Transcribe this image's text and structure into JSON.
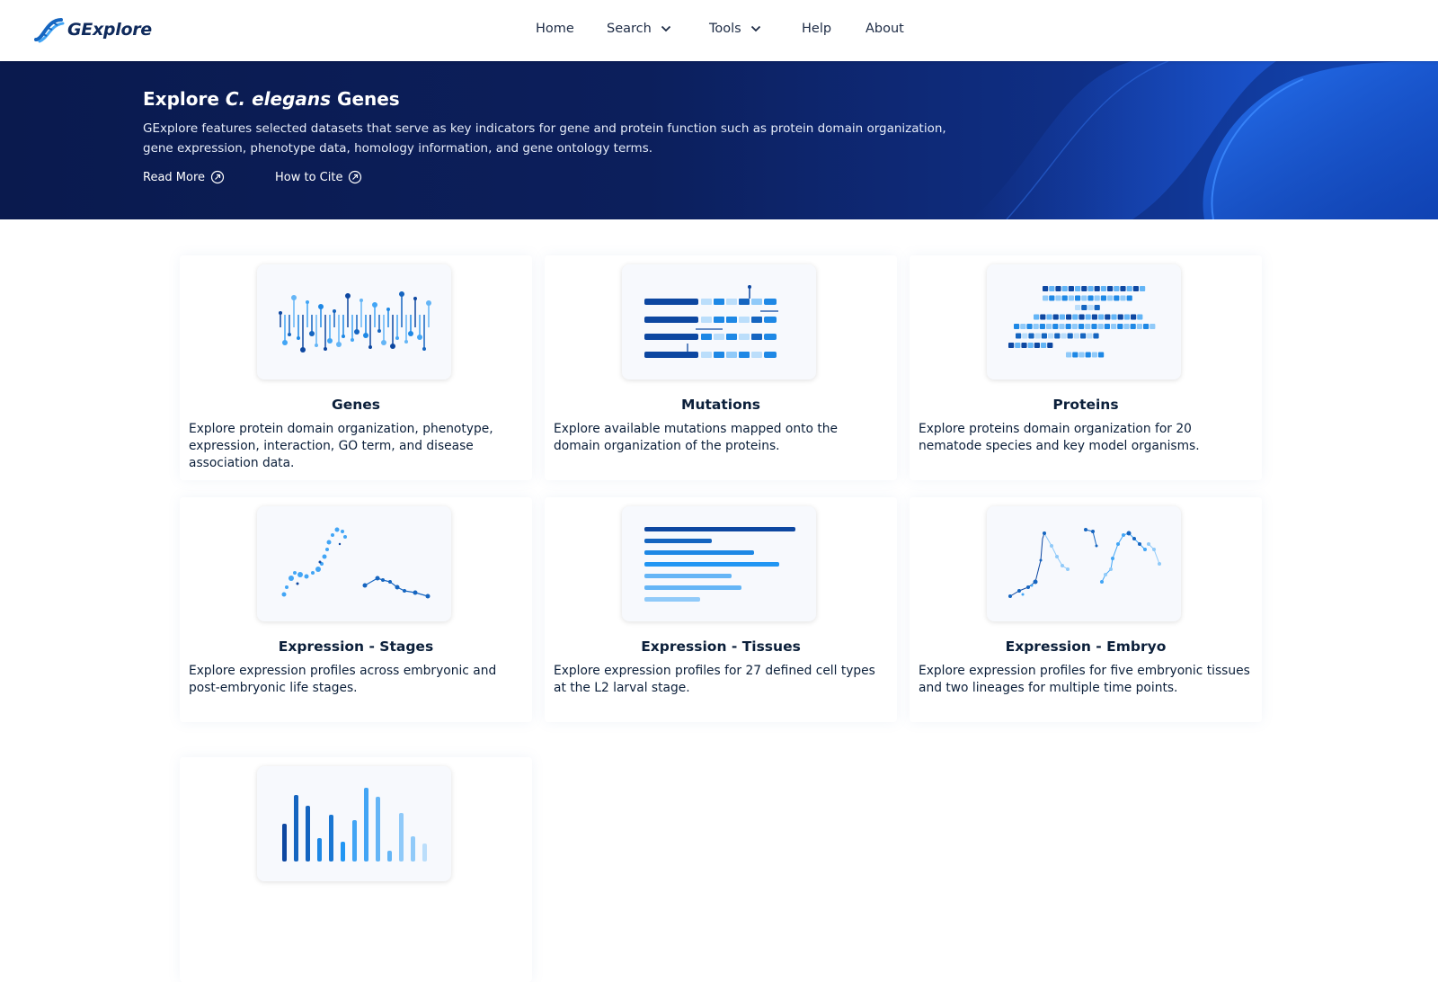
{
  "nav": {
    "brand": "GExplore",
    "items": [
      {
        "label": "Home"
      },
      {
        "label": "Search"
      },
      {
        "label": "Tools"
      },
      {
        "label": "Help"
      },
      {
        "label": "About"
      }
    ]
  },
  "hero": {
    "title_prefix": "Explore ",
    "title_species": "C. elegans",
    "title_suffix": " Genes",
    "description": "GExplore features selected datasets that serve as key indicators for gene and protein function such as protein domain organization, gene expression, phenotype data, homology information, and gene ontology terms.",
    "read_more": "Read More",
    "how_to_cite": "How to Cite"
  },
  "cards": [
    {
      "title": "Genes",
      "description": "Explore protein domain organization, phenotype, expression, interaction, GO term, and disease association data.",
      "icon": "gene-lollipop-icon"
    },
    {
      "title": "Mutations",
      "description": "Explore available mutations mapped onto the domain organization of the proteins.",
      "icon": "mutation-domain-icon"
    },
    {
      "title": "Proteins",
      "description": "Explore proteins domain organization for 20 nematode species and key model organisms.",
      "icon": "protein-domain-icon"
    },
    {
      "title": "Expression - Stages",
      "description": "Explore expression profiles across embryonic and post-embryonic life stages.",
      "icon": "stages-scatter-icon"
    },
    {
      "title": "Expression - Tissues",
      "description": "Explore expression profiles for 27 defined cell types at the L2 larval stage.",
      "icon": "tissues-bar-icon"
    },
    {
      "title": "Expression - Embryo",
      "description": "Explore expression profiles for five embryonic tissues and two lineages for multiple time points.",
      "icon": "embryo-scatter-icon"
    },
    {
      "title": "",
      "description": "",
      "icon": "histogram-icon"
    }
  ],
  "colors": {
    "dark": "#0d47a1",
    "mid": "#1e88e5",
    "light": "#90caf9",
    "navy": "#0a1a4e"
  }
}
